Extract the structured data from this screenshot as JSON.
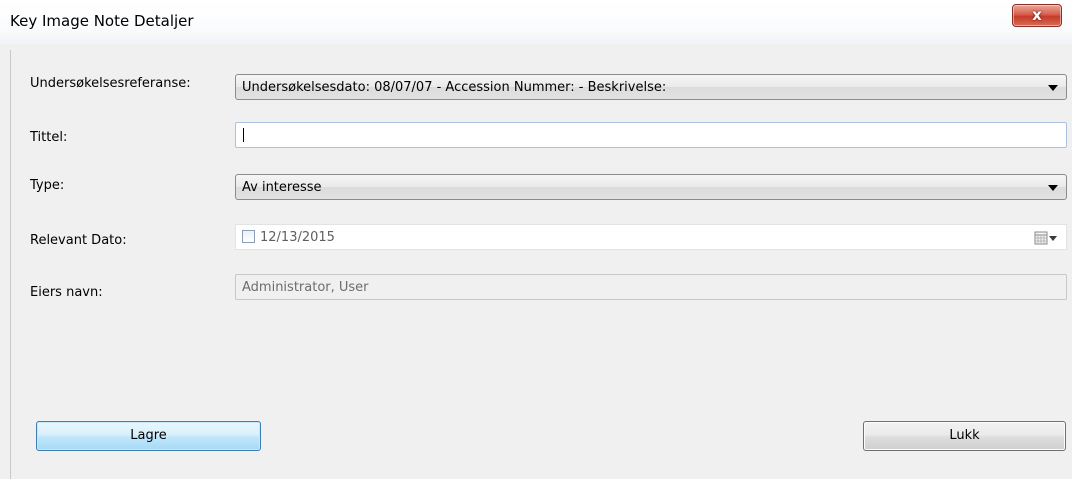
{
  "window": {
    "title": "Key Image Note Detaljer",
    "close_glyph": "x"
  },
  "form": {
    "exam_reference": {
      "label": "Undersøkelsesreferanse:",
      "value": "Undersøkelsesdato: 08/07/07 - Accession Nummer:  - Beskrivelse:"
    },
    "title": {
      "label": "Tittel:",
      "value": ""
    },
    "type": {
      "label": "Type:",
      "value": "Av interesse"
    },
    "relevant_date": {
      "label": "Relevant Dato:",
      "value": "12/13/2015",
      "checked": false
    },
    "owner_name": {
      "label": "Eiers navn:",
      "value": "Administrator, User"
    }
  },
  "buttons": {
    "save_label": "Lagre",
    "close_label": "Lukk"
  },
  "icons": {
    "close": "close-icon",
    "dropdown": "chevron-down-icon",
    "calendar": "calendar-icon",
    "checkbox": "checkbox-icon"
  },
  "colors": {
    "close_button": "#c63b29",
    "save_button_accent": "#bee6fd",
    "focus_border": "#abc1de"
  }
}
